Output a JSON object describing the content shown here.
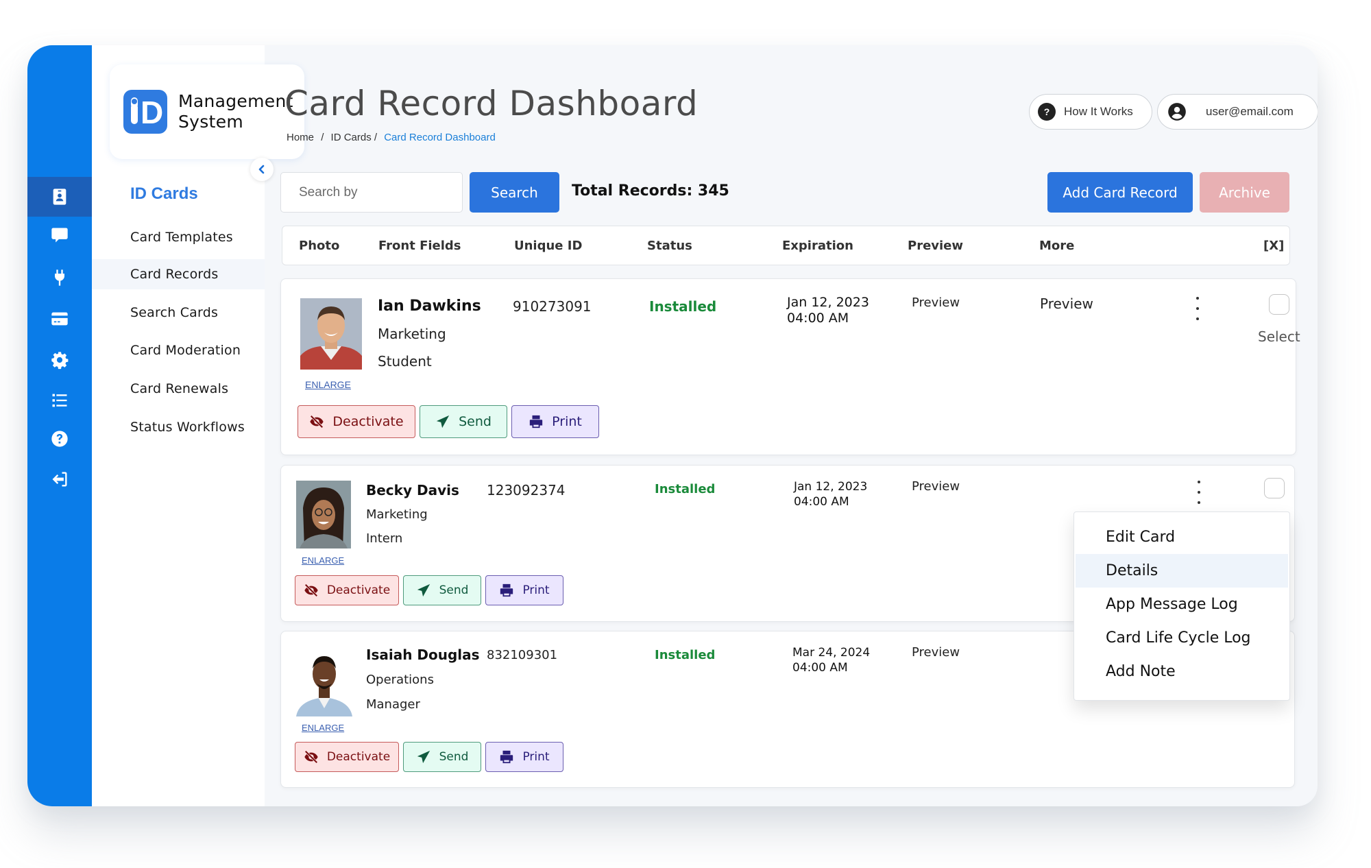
{
  "app": {
    "logo_mark": "D",
    "logo_title_line1": "Management",
    "logo_title_line2": "System"
  },
  "rail": {
    "items": [
      {
        "icon": "id-badge-icon",
        "active": true
      },
      {
        "icon": "chat-icon",
        "active": false
      },
      {
        "icon": "plug-icon",
        "active": false
      },
      {
        "icon": "credit-card-icon",
        "active": false
      },
      {
        "icon": "gear-icon",
        "active": false
      },
      {
        "icon": "list-icon",
        "active": false
      },
      {
        "icon": "help-icon",
        "active": false
      },
      {
        "icon": "logout-icon",
        "active": false
      }
    ]
  },
  "nav": {
    "title": "ID Cards",
    "items": [
      {
        "label": "Card Templates",
        "active": false
      },
      {
        "label": "Card Records",
        "active": true
      },
      {
        "label": "Search Cards",
        "active": false
      },
      {
        "label": "Card Moderation",
        "active": false
      },
      {
        "label": "Card Renewals",
        "active": false
      },
      {
        "label": "Status Workflows",
        "active": false
      }
    ]
  },
  "header": {
    "title": "Card Record Dashboard",
    "breadcrumb": [
      "Home",
      "/",
      "ID Cards /",
      "Card Record Dashboard"
    ],
    "how_it_works": "How It Works",
    "user_email": "user@email.com"
  },
  "toolbar": {
    "search_placeholder": "Search by",
    "search_label": "Search",
    "total_records": "Total Records: 345",
    "add_label": "Add Card Record",
    "archive_label": "Archive"
  },
  "table": {
    "columns": [
      "Photo",
      "Front Fields",
      "Unique ID",
      "Status",
      "Expiration",
      "Preview",
      "More",
      "[X]"
    ],
    "rows": [
      {
        "name": "Ian Dawkins",
        "department": "Marketing",
        "role": "Student",
        "unique_id": "910273091",
        "status": "Installed",
        "exp_date": "Jan 12, 2023",
        "exp_time": "04:00 AM",
        "preview": "Preview",
        "more_preview": "Preview",
        "select_label": "Select",
        "enlarge": "ENLARGE",
        "actions": {
          "deactivate": "Deactivate",
          "send": "Send",
          "print": "Print"
        }
      },
      {
        "name": "Becky Davis",
        "department": "Marketing",
        "role": "Intern",
        "unique_id": "123092374",
        "status": "Installed",
        "exp_date": "Jan 12, 2023",
        "exp_time": "04:00 AM",
        "preview": "Preview",
        "enlarge": "ENLARGE",
        "actions": {
          "deactivate": "Deactivate",
          "send": "Send",
          "print": "Print"
        }
      },
      {
        "name": "Isaiah Douglas",
        "department": "Operations",
        "role": "Manager",
        "unique_id": "832109301",
        "status": "Installed",
        "exp_date": "Mar 24, 2024",
        "exp_time": "04:00 AM",
        "preview": "Preview",
        "enlarge": "ENLARGE",
        "actions": {
          "deactivate": "Deactivate",
          "send": "Send",
          "print": "Print"
        }
      }
    ]
  },
  "more_menu": {
    "items": [
      "Edit Card",
      "Details",
      "App Message Log",
      "Card Life Cycle Log",
      "Add Note"
    ],
    "highlighted": "Details"
  },
  "colors": {
    "brand_blue": "#0a7ce8",
    "primary_button": "#2b74dd",
    "archive_button": "#e8b0b3",
    "status_installed": "#1a8a3a",
    "link_blue": "#1a7fd8"
  }
}
